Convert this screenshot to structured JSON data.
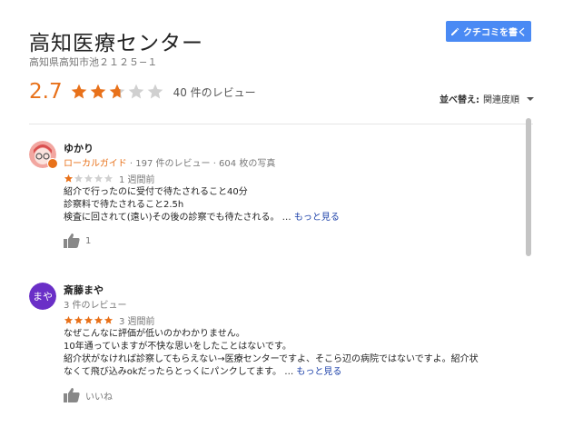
{
  "place": {
    "title": "高知医療センター",
    "address": "高知県高知市池２１２５−１"
  },
  "write_review_label": "クチコミを書く",
  "summary": {
    "rating": "2.7",
    "stars": 2.7,
    "count_label": "40 件のレビュー"
  },
  "sort": {
    "label": "並べ替え:",
    "value": "関連度順"
  },
  "reviews": [
    {
      "name": "ゆかり",
      "guide": "ローカルガイド",
      "meta": "· 197 件のレビュー · 604 枚の写真",
      "stars": 1,
      "time": "1 週間前",
      "lines": [
        "紹介で行ったのに受付で待たされること40分",
        "診察料で待たされること2.5h",
        "検査に回されて(遠い)その後の診察でも待たされる。 … "
      ],
      "more": "もっと見る",
      "likes": "1"
    },
    {
      "name": "斎藤まや",
      "initials": "まや",
      "meta": "3 件のレビュー",
      "stars": 5,
      "time": "3 週間前",
      "lines": [
        "なぜこんなに評価が低いのかわかりません。",
        "10年通っていますが不快な思いをしたことはないです。",
        "紹介状がなければ診察してもらえない→医療センターですよ、そこら辺の病院ではないですよ。紹介状",
        "なくて飛び込みokだったらとっくにパンクしてます。 … "
      ],
      "more": "もっと見る",
      "likes": "いいね"
    }
  ],
  "colors": {
    "accent_orange": "#e8711a",
    "button_blue": "#4a8af4",
    "link_blue": "#1a3fa8",
    "star_empty": "#d0d0d0"
  }
}
